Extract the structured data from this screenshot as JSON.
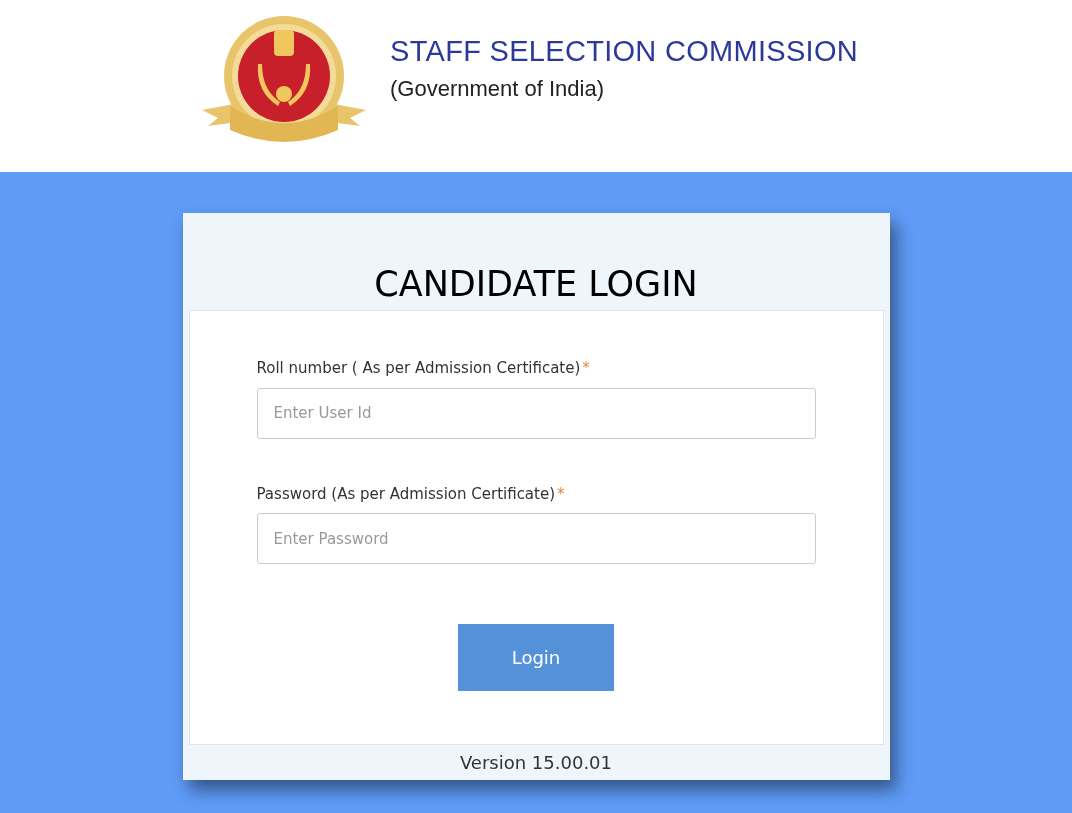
{
  "header": {
    "title": "STAFF SELECTION COMMISSION",
    "subtitle": "(Government of India)"
  },
  "login": {
    "title": "CANDIDATE LOGIN",
    "fields": [
      {
        "label": "Roll number ( As per Admission Certificate)",
        "required_mark": "*",
        "placeholder": "Enter User Id"
      },
      {
        "label": "Password (As per Admission Certificate)",
        "required_mark": "*",
        "placeholder": "Enter Password"
      }
    ],
    "button": "Login",
    "version": "Version 15.00.01"
  }
}
